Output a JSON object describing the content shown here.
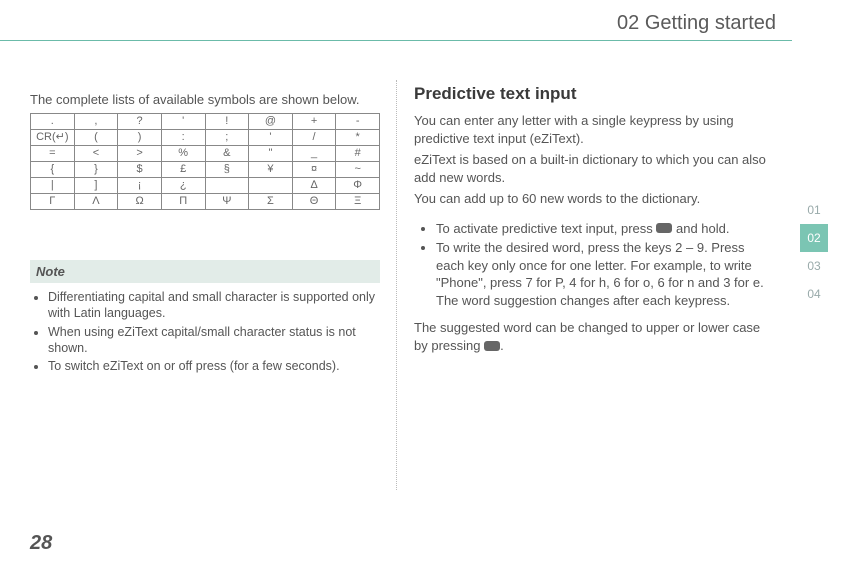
{
  "header": "02 Getting started",
  "pageNumber": "28",
  "tabs": [
    "01",
    "02",
    "03",
    "04"
  ],
  "activeTab": 1,
  "left": {
    "intro": "The complete lists of available symbols are shown below.",
    "symbolRows": [
      [
        ".",
        ",",
        "?",
        "'",
        "!",
        "@",
        "+",
        "-"
      ],
      [
        "CR(↵)",
        "(",
        ")",
        ":",
        ";",
        "'",
        "/",
        "*"
      ],
      [
        "=",
        "<",
        ">",
        "%",
        "&",
        "\"",
        "_",
        "#"
      ],
      [
        "{",
        "}",
        "$",
        "£",
        "§",
        "¥",
        "¤",
        "~"
      ],
      [
        "|",
        "]",
        "¡",
        "¿",
        "",
        "",
        "∆",
        "Φ"
      ],
      [
        "Γ",
        "Λ",
        "Ω",
        "Π",
        "Ψ",
        "Σ",
        "Θ",
        "Ξ"
      ]
    ],
    "noteTitle": "Note",
    "noteItems": [
      "Differentiating capital and small character is supported only with Latin languages.",
      "When using eZiText capital/small character status is not shown.",
      "To switch eZiText on or off press (for a few seconds)."
    ]
  },
  "right": {
    "title": "Predictive text input",
    "p1": "You can enter any letter with a single keypress by using predictive text input (eZiText).",
    "p2": "eZiText is based on a built-in dictionary to which you can also add new words.",
    "p3": "You can add up to 60 new words to the dictionary.",
    "b1a": "To activate predictive text input, press ",
    "b1b": " and hold.",
    "b2": "To write the desired word, press the keys 2 – 9. Press each key only once for one letter. For example, to write \"Phone\", press 7 for P, 4 for h, 6 for o, 6 for n and 3 for e.",
    "b2line2": "The word suggestion changes after each keypress.",
    "p4a": "The suggested word can be changed to upper or lower case by pressing ",
    "p4b": "."
  }
}
